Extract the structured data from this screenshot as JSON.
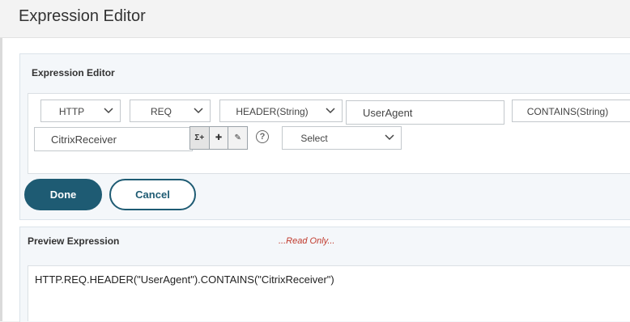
{
  "window": {
    "title": "Expression Editor"
  },
  "editor": {
    "title": "Expression Editor",
    "dropdowns": {
      "protocol": "HTTP",
      "direction": "REQ",
      "method": "HEADER(String)",
      "operator": "CONTAINS(String)",
      "select": "Select"
    },
    "fields": {
      "header_name": "UserAgent",
      "value": "CitrixReceiver"
    },
    "tools": {
      "sum_plus": "Σ+",
      "add": "✚",
      "edit": "✎"
    },
    "help_glyph": "?"
  },
  "buttons": {
    "done": "Done",
    "cancel": "Cancel"
  },
  "preview": {
    "title": "Preview Expression",
    "readonly_note": "...Read Only...",
    "expression": "HTTP.REQ.HEADER(\"UserAgent\").CONTAINS(\"CitrixReceiver\")"
  },
  "colors": {
    "primary": "#1e5b73",
    "readonly": "#c0392b"
  }
}
